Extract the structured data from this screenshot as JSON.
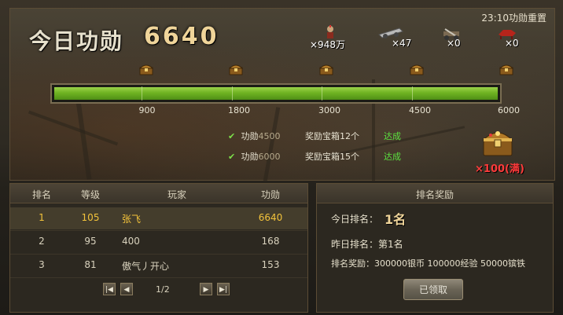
{
  "reset_time": "23:10功勋重置",
  "title": {
    "label": "今日功勋",
    "value": "6640"
  },
  "resources": [
    {
      "icon": "soldier-icon",
      "text": "×948万"
    },
    {
      "icon": "cannon-icon",
      "text": "×47"
    },
    {
      "icon": "siege-weapon-icon",
      "text": "×0"
    },
    {
      "icon": "red-horse-icon",
      "text": "×0"
    }
  ],
  "progress": {
    "fraction": 1.0,
    "ticks": [
      "900",
      "1800",
      "3000",
      "4500",
      "6000"
    ]
  },
  "milestones": [
    {
      "label": "功勋",
      "num": "4500",
      "reward": "奖励宝箱12个",
      "status": "达成"
    },
    {
      "label": "功勋",
      "num": "6000",
      "reward": "奖励宝箱15个",
      "status": "达成"
    }
  ],
  "big_chest": {
    "count": "×100(满)"
  },
  "ranking": {
    "headers": [
      "排名",
      "等级",
      "玩家",
      "功勋"
    ],
    "rows": [
      {
        "rank": "1",
        "level": "105",
        "name": "张飞",
        "score": "6640"
      },
      {
        "rank": "2",
        "level": "95",
        "name": "400",
        "score": "168"
      },
      {
        "rank": "3",
        "level": "81",
        "name": "傲气丿开心",
        "score": "153"
      }
    ],
    "page": "1/2"
  },
  "reward_panel": {
    "title": "排名奖励",
    "today_label": "今日排名：",
    "today_value": "1名",
    "yesterday": "昨日排名：第1名",
    "rewards": "排名奖励：300000银币 100000经验 50000镔铁",
    "claim_button": "已领取"
  },
  "colors": {
    "progress_green": "#6fb322",
    "highlight_gold": "#f3c33b",
    "done_green": "#5be03f",
    "chest_count_red": "#ff3b3b"
  }
}
